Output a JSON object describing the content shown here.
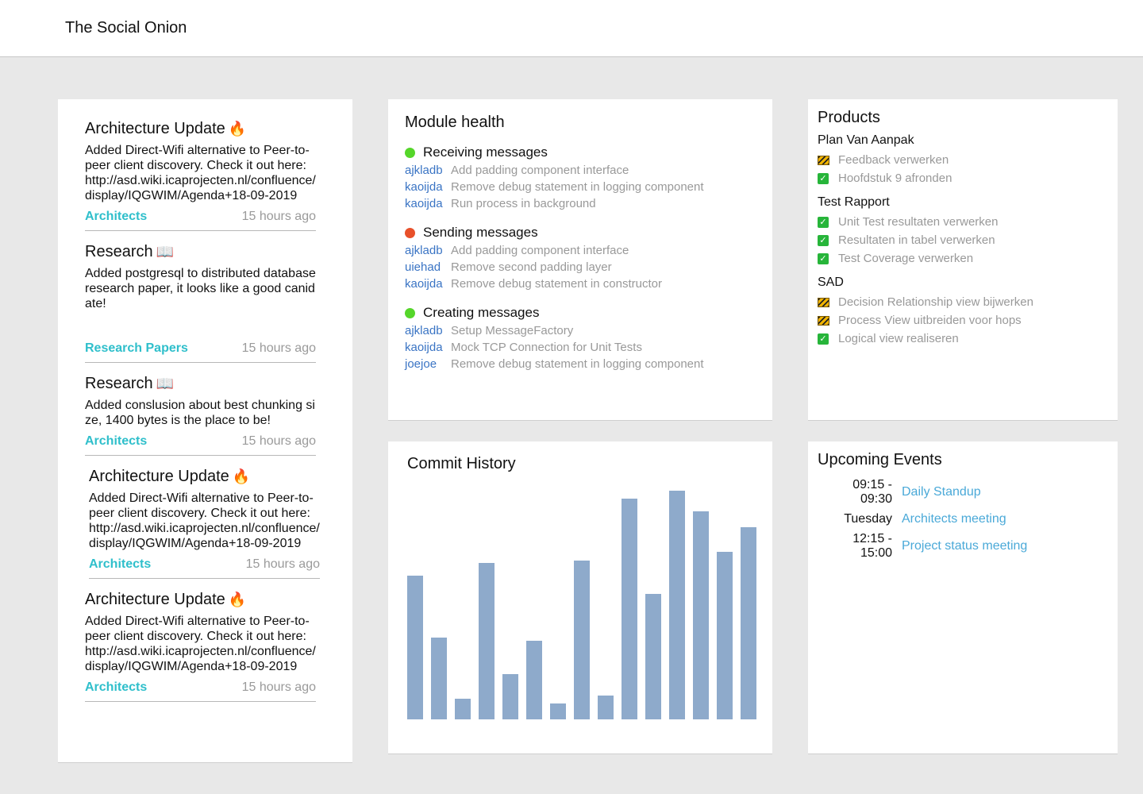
{
  "app": {
    "title": "The Social Onion"
  },
  "feed": {
    "posts": [
      {
        "title": "Architecture Update",
        "icon": "🔥",
        "body": "Added Direct-Wifi alternative to Peer-to-peer client discovery. Check it out here: http://asd.wiki.icaprojecten.nl/confluence/display/IQGWIM/Agenda+18-09-2019",
        "tag": "Architects",
        "time": "15 hours ago"
      },
      {
        "title": "Research",
        "icon": "📖",
        "body": "Added postgresql to distributed database research paper, it looks like a good canidate!",
        "tag": "Research Papers",
        "time": "15 hours ago"
      },
      {
        "title": "Research",
        "icon": "📖",
        "body": "Added conslusion about best chunking size, 1400 bytes is the place to be!",
        "tag": "Architects",
        "time": "15 hours ago"
      },
      {
        "title": "Architecture Update",
        "icon": "🔥",
        "body": "Added Direct-Wifi alternative to Peer-to-peer client discovery. Check it out here: http://asd.wiki.icaprojecten.nl/confluence/display/IQGWIM/Agenda+18-09-2019",
        "tag": "Architects",
        "time": "15 hours ago"
      },
      {
        "title": "Architecture Update",
        "icon": "🔥",
        "body": "Added Direct-Wifi alternative to Peer-to-peer client discovery. Check it out here: http://asd.wiki.icaprojecten.nl/confluence/display/IQGWIM/Agenda+18-09-2019",
        "tag": "Architects",
        "time": "15 hours ago"
      }
    ]
  },
  "health": {
    "title": "Module health",
    "modules": [
      {
        "name": "Receiving messages",
        "status_color": "#55d62a",
        "commits": [
          {
            "author": "ajkladb",
            "message": "Add padding component interface"
          },
          {
            "author": "kaoijda",
            "message": "Remove debug statement in logging component"
          },
          {
            "author": "kaoijda",
            "message": "Run process in background"
          }
        ]
      },
      {
        "name": "Sending messages",
        "status_color": "#e8502a",
        "commits": [
          {
            "author": "ajkladb",
            "message": "Add padding component interface"
          },
          {
            "author": "uiehad",
            "message": "Remove second padding layer"
          },
          {
            "author": "kaoijda",
            "message": "Remove debug statement in constructor"
          }
        ]
      },
      {
        "name": "Creating messages",
        "status_color": "#55d62a",
        "commits": [
          {
            "author": "ajkladb",
            "message": "Setup MessageFactory"
          },
          {
            "author": "kaoijda",
            "message": "Mock TCP Connection for Unit Tests"
          },
          {
            "author": "joejoe",
            "message": "Remove debug statement in logging component"
          }
        ]
      }
    ]
  },
  "products": {
    "title": "Products",
    "groups": [
      {
        "name": "Plan Van Aanpak",
        "tasks": [
          {
            "label": "Feedback verwerken",
            "status": "construction-icon"
          },
          {
            "label": "Hoofdstuk 9 afronden",
            "status": "checkbox-icon"
          }
        ]
      },
      {
        "name": "Test Rapport",
        "tasks": [
          {
            "label": "Unit Test resultaten verwerken",
            "status": "checkbox-icon"
          },
          {
            "label": "Resultaten in tabel verwerken",
            "status": "checkbox-icon"
          },
          {
            "label": "Test Coverage verwerken",
            "status": "checkbox-icon"
          }
        ]
      },
      {
        "name": "SAD",
        "tasks": [
          {
            "label": "Decision Relationship view bijwerken",
            "status": "construction-icon"
          },
          {
            "label": "Process View uitbreiden voor hops",
            "status": "construction-icon"
          },
          {
            "label": "Logical view realiseren",
            "status": "checkbox-icon"
          }
        ]
      }
    ]
  },
  "commit_history": {
    "title": "Commit History",
    "bar_color": "#8eaacb",
    "values": [
      181,
      103,
      26,
      197,
      57,
      99,
      20,
      200,
      30,
      278,
      158,
      288,
      262,
      211,
      242
    ]
  },
  "events": {
    "title": "Upcoming Events",
    "items": [
      {
        "time": "09:15 - 09:30",
        "name": "Daily Standup"
      },
      {
        "time": "Tuesday",
        "name": "Architects meeting"
      },
      {
        "time": "12:15 - 15:00",
        "name": "Project status meeting"
      }
    ]
  }
}
